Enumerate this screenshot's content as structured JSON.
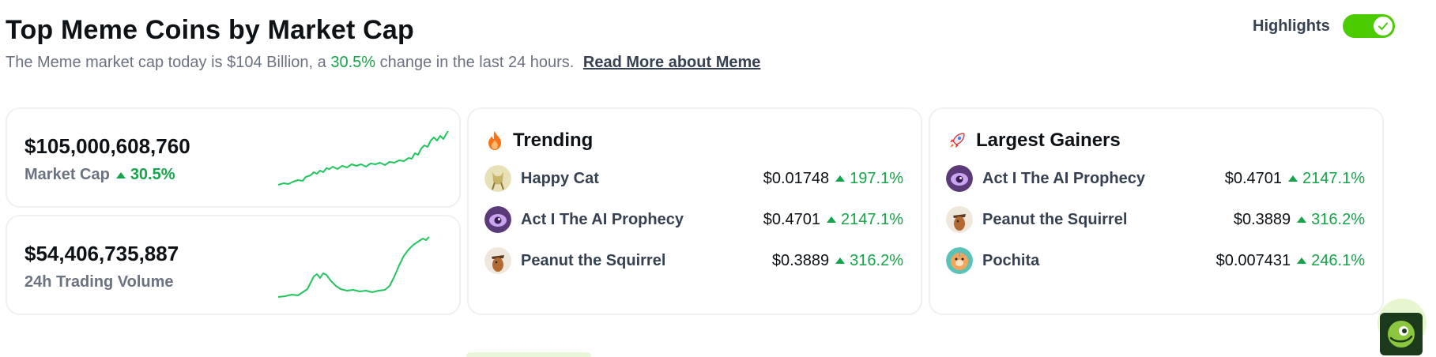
{
  "header": {
    "title": "Top Meme Coins by Market Cap",
    "subtitle_prefix": "The Meme market cap today is $104 Billion, a",
    "subtitle_pct": "30.5%",
    "subtitle_suffix": "change in the last 24 hours.",
    "read_more": "Read More about Meme"
  },
  "highlights": {
    "label": "Highlights",
    "enabled": true
  },
  "stats": [
    {
      "value": "$105,000,608,760",
      "label": "Market Cap",
      "change": "30.5%"
    },
    {
      "value": "$54,406,735,887",
      "label": "24h Trading Volume"
    }
  ],
  "trending": {
    "title": "Trending",
    "icon": "fire-icon",
    "items": [
      {
        "name": "Happy Cat",
        "price": "$0.01748",
        "change": "197.1%"
      },
      {
        "name": "Act I The AI Prophecy",
        "price": "$0.4701",
        "change": "2147.1%"
      },
      {
        "name": "Peanut the Squirrel",
        "price": "$0.3889",
        "change": "316.2%"
      }
    ]
  },
  "gainers": {
    "title": "Largest Gainers",
    "icon": "rocket-icon",
    "items": [
      {
        "name": "Act I The AI Prophecy",
        "price": "$0.4701",
        "change": "2147.1%"
      },
      {
        "name": "Peanut the Squirrel",
        "price": "$0.3889",
        "change": "316.2%"
      },
      {
        "name": "Pochita",
        "price": "$0.007431",
        "change": "246.1%"
      }
    ]
  },
  "colors": {
    "positive": "#16a34a",
    "toggle": "#4bcc00",
    "spark": "#22c55e"
  }
}
